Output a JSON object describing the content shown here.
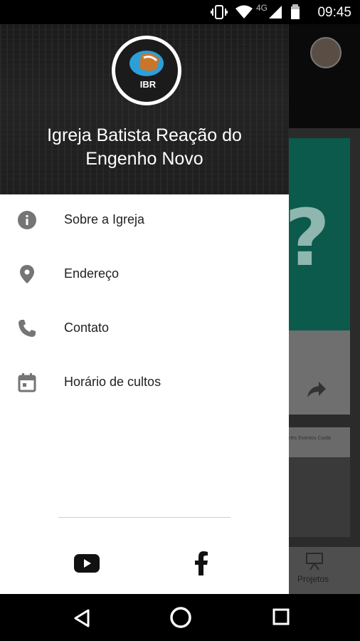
{
  "status_bar": {
    "time": "09:45",
    "network": "4G"
  },
  "drawer": {
    "church_name_line1": "Igreja Batista Reação do",
    "church_name_line2": "Engenho Novo",
    "logo_text": "IBR",
    "items": [
      {
        "label": "Sobre a Igreja",
        "icon": "info-icon"
      },
      {
        "label": "Endereço",
        "icon": "location-pin-icon"
      },
      {
        "label": "Contato",
        "icon": "phone-icon"
      },
      {
        "label": "Horário de cultos",
        "icon": "calendar-icon"
      }
    ],
    "social": [
      {
        "name": "youtube-icon"
      },
      {
        "name": "facebook-icon"
      }
    ]
  },
  "background_app": {
    "card2_tabs": "rles   Eventos   Cuida",
    "bottom_nav_label": "Projetos"
  },
  "colors": {
    "drawer_bg": "#ffffff",
    "menu_icon": "#757575",
    "menu_text": "#212121",
    "nav_bar": "#000000"
  }
}
